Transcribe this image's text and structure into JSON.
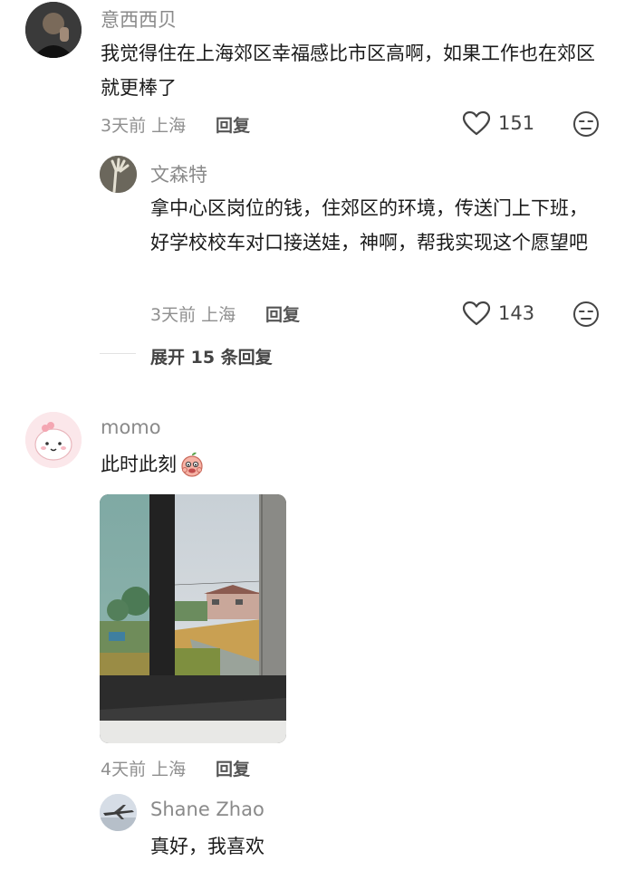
{
  "comments": [
    {
      "user": "意西西贝",
      "text": "我觉得住在上海郊区幸福感比市区高啊，如果工作也在郊区就更棒了",
      "time": "3天前 上海",
      "reply_label": "回复",
      "likes": "151",
      "replies": [
        {
          "user": "文森特",
          "text": "拿中心区岗位的钱，住郊区的环境，传送门上下班，好学校校车对口接送娃，神啊，帮我实现这个愿望吧",
          "time": "3天前 上海",
          "reply_label": "回复",
          "likes": "143"
        }
      ],
      "expand_label": "展开 15 条回复"
    },
    {
      "user": "momo",
      "text": "此时此刻",
      "time": "4天前 上海",
      "reply_label": "回复",
      "replies": [
        {
          "user": "Shane Zhao",
          "text": "真好，我喜欢"
        }
      ]
    }
  ],
  "icons": {
    "like": "heart-outline-icon",
    "dislike": "unamused-face-icon",
    "sticker": "peach-sticker-icon"
  },
  "colors": {
    "username": "#8a8a8a",
    "meta": "#8f8f8f",
    "text": "#1a1a1a"
  }
}
